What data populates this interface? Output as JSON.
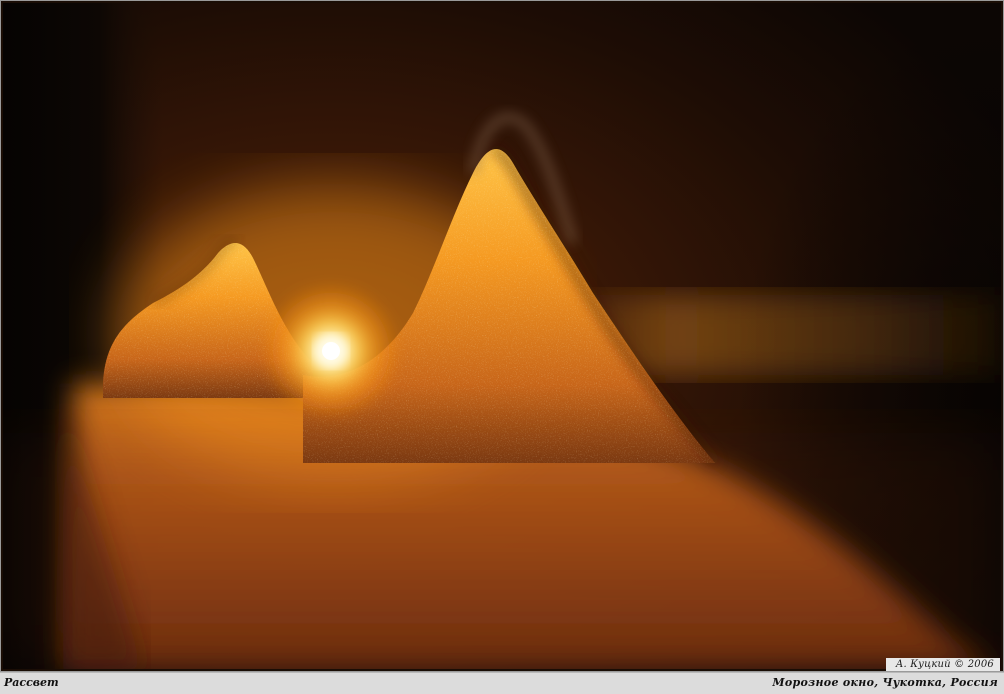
{
  "photo": {
    "title": "Рассвет",
    "caption": "Морозное окно, Чукотка, Россия",
    "credit": "А. Куцкий © 2006",
    "description_colors": {
      "glow": "#ffb21f",
      "core": "#fff7c8",
      "dark": "#140904",
      "frost": "#e2891d"
    }
  }
}
